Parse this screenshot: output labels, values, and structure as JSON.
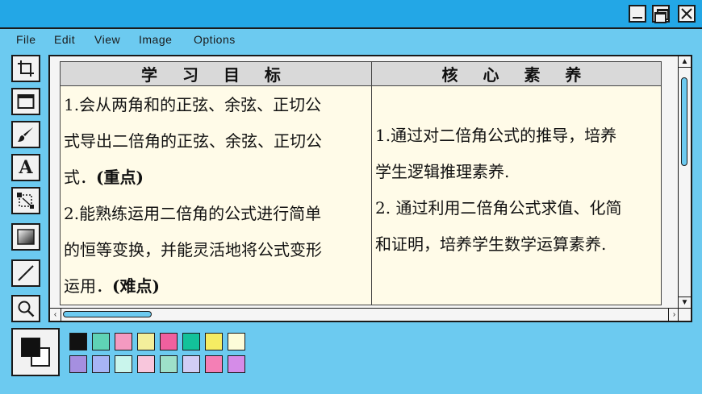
{
  "window": {
    "controls": {
      "minimize_icon": "minimize-icon",
      "maximize_icon": "maximize-icon",
      "close_icon": "close-icon"
    }
  },
  "menu": {
    "items": [
      {
        "label": "File"
      },
      {
        "label": "Edit"
      },
      {
        "label": "View"
      },
      {
        "label": "Image"
      },
      {
        "label": "Options"
      }
    ]
  },
  "toolbar": {
    "tools": [
      {
        "icon": "crop-icon"
      },
      {
        "icon": "rectangle-icon"
      },
      {
        "icon": "brush-icon"
      },
      {
        "icon": "text-icon",
        "glyph": "A"
      },
      {
        "icon": "select-transform-icon"
      },
      {
        "icon": "gradient-icon"
      },
      {
        "icon": "line-icon"
      },
      {
        "icon": "zoom-icon"
      }
    ]
  },
  "document": {
    "table": {
      "headers": [
        "学 习 目 标",
        "核 心 素 养"
      ],
      "left": {
        "line1": "1.会从两角和的正弦、余弦、正切公",
        "line2": "式导出二倍角的正弦、余弦、正切公",
        "line3_text": "式．",
        "line3_bold": "(重点)",
        "line4": "2.能熟练运用二倍角的公式进行简单",
        "line5": "的恒等变换，并能灵活地将公式变形",
        "line6_text": "运用．",
        "line6_bold": "(难点)"
      },
      "right": {
        "line1": "1.通过对二倍角公式的推导，培养",
        "line2": "学生逻辑推理素养.",
        "line3": "2. 通过利用二倍角公式求值、化简",
        "line4": "和证明，培养学生数学运算素养."
      }
    }
  },
  "colors": {
    "foreground": "#111111",
    "background": "#ffffff",
    "palette_row1": [
      "#111111",
      "#5fd3b5",
      "#f49ac1",
      "#f3ef9b",
      "#f0609e",
      "#13c29a",
      "#f5ec63",
      "#fcfcd9"
    ],
    "palette_row2": [
      "#a58fe0",
      "#a7b4f5",
      "#c9f5ec",
      "#f8c6dc",
      "#9ee0c9",
      "#d2cdf5",
      "#f47fb5",
      "#d58ce8"
    ]
  }
}
